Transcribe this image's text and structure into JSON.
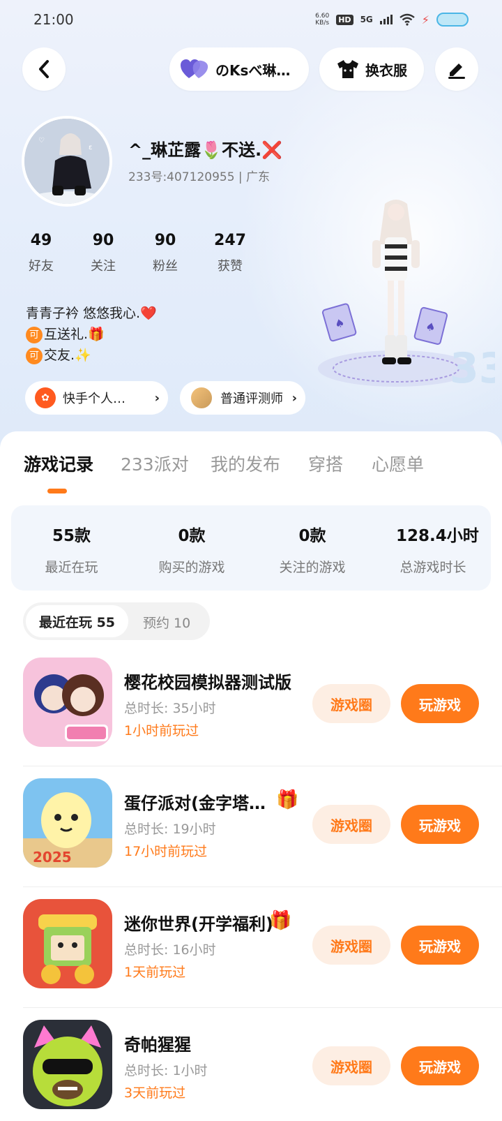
{
  "status_bar": {
    "time": "21:00",
    "net_speed_value": "6.60",
    "net_speed_unit": "KB/s",
    "hd": "HD",
    "network": "5G"
  },
  "header": {
    "couple_label": "のKsべ琳…",
    "dress_label": "换衣服"
  },
  "profile": {
    "nickname": "^_琳芷露🌷不送.❌",
    "id_line": "233号:407120955 | 广东",
    "stats": [
      {
        "value": "49",
        "label": "好友"
      },
      {
        "value": "90",
        "label": "关注"
      },
      {
        "value": "90",
        "label": "粉丝"
      },
      {
        "value": "247",
        "label": "获赞"
      }
    ],
    "bio": {
      "line1": "青青子衿 悠悠我心.❤️",
      "tag": "可",
      "line2": "互送礼.🎁",
      "line3": "交友.✨"
    },
    "pills": {
      "kuaishou": "快手个人…",
      "evaluator": "普通评测师"
    }
  },
  "tabs": [
    "游戏记录",
    "233派对",
    "我的发布",
    "穿搭",
    "心愿单"
  ],
  "summary": [
    {
      "value": "55款",
      "label": "最近在玩"
    },
    {
      "value": "0款",
      "label": "购买的游戏"
    },
    {
      "value": "0款",
      "label": "关注的游戏"
    },
    {
      "value": "128.4小时",
      "label": "总游戏时长"
    }
  ],
  "segment": {
    "active": "最近在玩 55",
    "inactive": "预约 10"
  },
  "buttons": {
    "circle": "游戏圈",
    "play": "玩游戏"
  },
  "games": [
    {
      "name": "樱花校园模拟器测试版",
      "time": "总时长: 35小时",
      "last": "1小时前玩过",
      "gift": false
    },
    {
      "name": "蛋仔派对(金字塔…",
      "time": "总时长: 19小时",
      "last": "17小时前玩过",
      "gift": true
    },
    {
      "name": "迷你世界(开学福利)",
      "time": "总时长: 16小时",
      "last": "1天前玩过",
      "gift": true
    },
    {
      "name": "奇帕猩猩",
      "time": "总时长: 1小时",
      "last": "3天前玩过",
      "gift": false
    }
  ]
}
